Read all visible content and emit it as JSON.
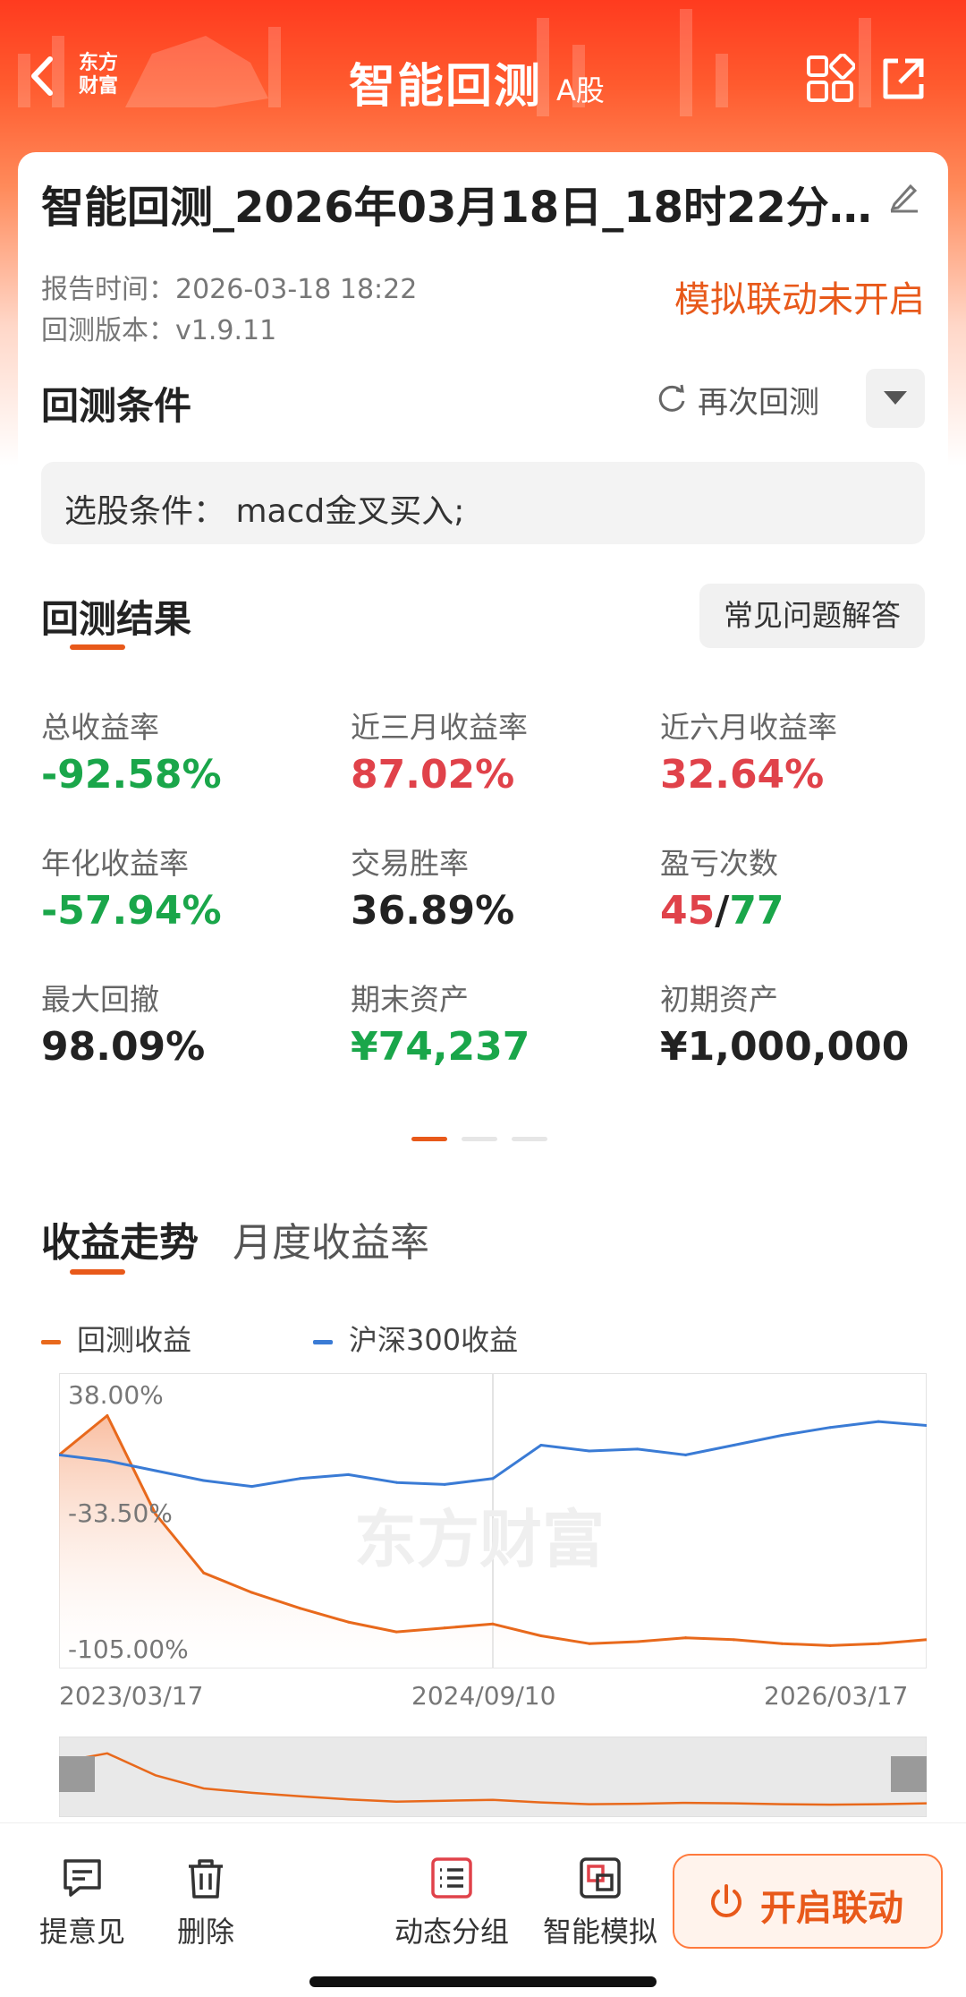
{
  "header": {
    "brand": "东方\n财富",
    "title": "智能回测",
    "market": "A股",
    "icons": [
      "back-icon",
      "grid-icon",
      "share-icon"
    ],
    "bg_color": "#ff3b1f"
  },
  "report": {
    "title": "智能回测_2026年03月18日_18时22分…",
    "time_label": "报告时间：",
    "time_value": "2026-03-18 18:22",
    "version_label": "回测版本：",
    "version_value": "v1.9.11",
    "sim_status": "模拟联动未开启"
  },
  "conditions": {
    "title": "回测条件",
    "retest_label": "再次回测",
    "stock_selection": "选股条件：  macd金叉买入;"
  },
  "results": {
    "title": "回测结果",
    "faq_label": "常见问题解答",
    "metrics": [
      {
        "label": "总收益率",
        "value": "-92.58%",
        "color": "green"
      },
      {
        "label": "近三月收益率",
        "value": "87.02%",
        "color": "red"
      },
      {
        "label": "近六月收益率",
        "value": "32.64%",
        "color": "red"
      },
      {
        "label": "年化收益率",
        "value": "-57.94%",
        "color": "green"
      },
      {
        "label": "交易胜率",
        "value": "36.89%",
        "color": "dark"
      },
      {
        "label": "盈亏次数",
        "value": "",
        "color": "dark"
      },
      {
        "label": "最大回撤",
        "value": "98.09%",
        "color": "dark"
      },
      {
        "label": "期末资产",
        "value": "¥74,237",
        "color": "green"
      },
      {
        "label": "初期资产",
        "value": "¥1,000,000",
        "color": "dark"
      }
    ],
    "win_count": "45",
    "slash": "/",
    "loss_count": "77"
  },
  "trend": {
    "tab_active": "收益走势",
    "tab_inactive": "月度收益率",
    "legend_backtest": "回测收益",
    "legend_hs300": "沪深300收益",
    "watermark": "东方财富"
  },
  "chart_data": {
    "type": "line",
    "y_ticks": [
      "38.00%",
      "-33.50%",
      "-105.00%"
    ],
    "x_ticks": [
      "2023/03/17",
      "2024/09/10",
      "2026/03/17"
    ],
    "ylim": [
      -105,
      38
    ],
    "x": [
      "2023-03",
      "2023-05",
      "2023-07",
      "2023-09",
      "2023-11",
      "2024-01",
      "2024-03",
      "2024-05",
      "2024-07",
      "2024-09",
      "2024-11",
      "2025-01",
      "2025-03",
      "2025-05",
      "2025-07",
      "2025-09",
      "2025-11",
      "2026-01",
      "2026-03"
    ],
    "series": [
      {
        "name": "回测收益",
        "color": "#e8691c",
        "values": [
          0,
          20,
          -30,
          -60,
          -70,
          -78,
          -85,
          -90,
          -88,
          -86,
          -92,
          -96,
          -95,
          -93,
          -94,
          -96,
          -97,
          -96,
          -94
        ]
      },
      {
        "name": "沪深300收益",
        "color": "#3a7bd5",
        "values": [
          0,
          -3,
          -8,
          -13,
          -16,
          -12,
          -10,
          -14,
          -15,
          -12,
          5,
          2,
          3,
          0,
          5,
          10,
          14,
          17,
          15
        ]
      }
    ]
  },
  "bottom": {
    "feedback": "提意见",
    "delete": "删除",
    "group": "动态分组",
    "simulate": "智能模拟",
    "link": "开启联动"
  }
}
